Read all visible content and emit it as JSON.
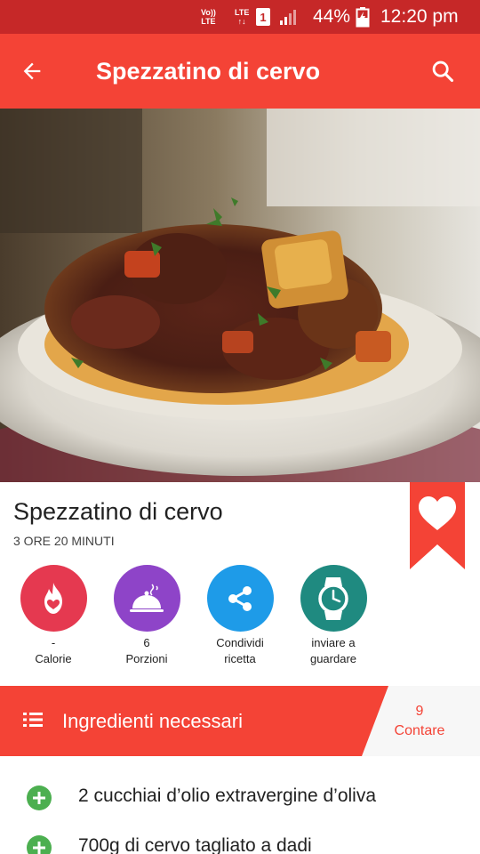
{
  "status_bar": {
    "volte_top": "Vo))",
    "volte_bottom": "LTE",
    "lte_label": "LTE",
    "lte_arrows": "↑↓",
    "sim_slot": "1",
    "battery_percent": "44%",
    "time": "12:20 pm"
  },
  "app_bar": {
    "back_icon": "arrow-left-icon",
    "title": "Spezzatino di cervo",
    "search_icon": "search-icon"
  },
  "recipe": {
    "title": "Spezzatino di cervo",
    "time": "3 ORE 20 MINUTI",
    "favorite_icon": "heart-icon"
  },
  "actions": [
    {
      "icon": "flame-heart-icon",
      "value": "-",
      "label": "Calorie",
      "color": "#e53950"
    },
    {
      "icon": "cloche-icon",
      "value": "6",
      "label": "Porzioni",
      "color": "#8e44c8"
    },
    {
      "icon": "share-icon",
      "line1": "Condividi",
      "line2": "ricetta",
      "color": "#1e9be8"
    },
    {
      "icon": "watch-icon",
      "line1": "inviare a",
      "line2": "guardare",
      "color": "#1f8a80"
    }
  ],
  "ingredients": {
    "header_icon": "list-icon",
    "title": "Ingredienti necessari",
    "count": "9",
    "count_label": "Contare",
    "items": [
      "2 cucchiai d’olio extravergine d’oliva",
      "700g di cervo tagliato a dadi"
    ]
  },
  "colors": {
    "status_bar": "#c62828",
    "accent": "#f44336",
    "add_button": "#4caf50"
  }
}
